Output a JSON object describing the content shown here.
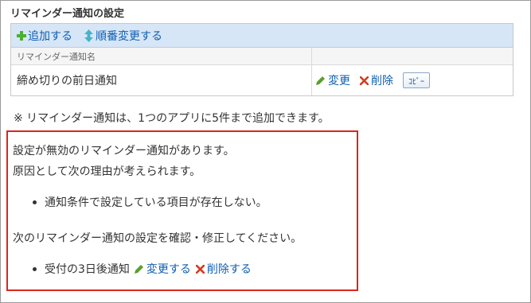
{
  "section_title": "リマインダー通知の設定",
  "toolbar": {
    "add_label": "追加する",
    "reorder_label": "順番変更する"
  },
  "table": {
    "header": "リマインダー通知名",
    "rows": [
      {
        "name": "締め切りの前日通知",
        "edit_label": "変更",
        "delete_label": "削除",
        "copy_label": "ｺﾋﾟｰ"
      }
    ]
  },
  "note": "※ リマインダー通知は、1つのアプリに5件まで追加できます。",
  "warning": {
    "line1": "設定が無効のリマインダー通知があります。",
    "line2": "原因として次の理由が考えられます。",
    "reason": "通知条件で設定している項目が存在しない。",
    "instruction": "次のリマインダー通知の設定を確認・修正してください。",
    "item_name": "受付の3日後通知",
    "item_edit_label": "変更する",
    "item_delete_label": "削除する"
  },
  "colors": {
    "link": "#0f5fb2",
    "toolbar_bg": "#d6e6f7",
    "warning_border": "#d9261c",
    "add_icon": "#4caf2e",
    "edit_icon": "#5aa02c",
    "delete_icon": "#d63a1f"
  },
  "icons": {
    "add": "plus-icon",
    "reorder": "up-down-arrow-icon",
    "edit": "pencil-icon",
    "delete": "x-icon"
  }
}
